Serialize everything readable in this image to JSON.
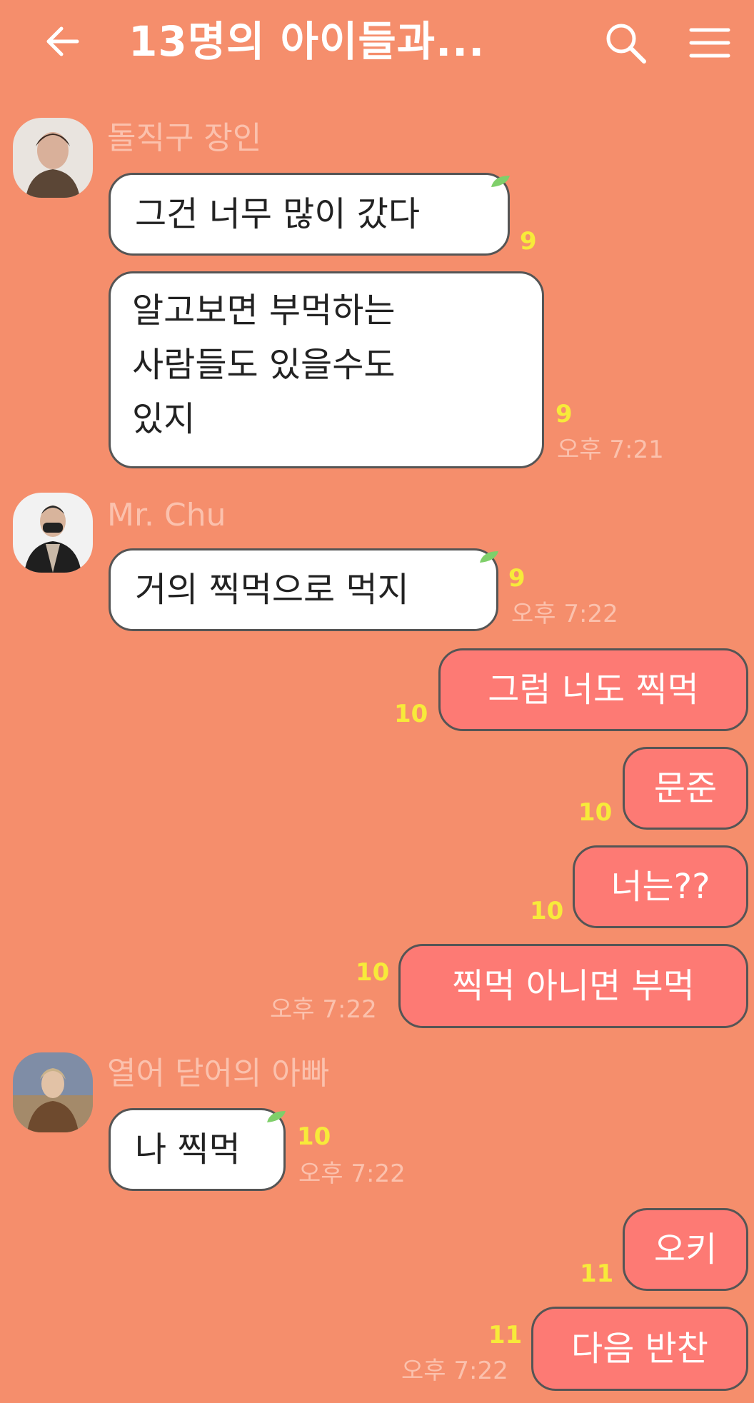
{
  "header": {
    "title": "13명의 아이들과...",
    "back_icon": "arrow-left-icon",
    "search_icon": "search-icon",
    "menu_icon": "hamburger-menu-icon"
  },
  "colors": {
    "background": "#f58e6c",
    "incoming_bubble": "#ffffff",
    "outgoing_bubble": "#fd7a74",
    "unread_count": "#f7ea3a",
    "meta_text": "#fbc1ad"
  },
  "messages": [
    {
      "sender": "돌직구 장인",
      "text": "그건 너무 많이 갔다",
      "unread": "9"
    },
    {
      "lines": [
        "알고보면 부먹하는",
        "사람들도 있을수도",
        "있지"
      ],
      "unread": "9",
      "time": "오후 7:21"
    },
    {
      "sender": "Mr. Chu",
      "text": "거의 찍먹으로 먹지",
      "unread": "9",
      "time": "오후 7:22"
    },
    {
      "text": "그럼 너도 찍먹",
      "unread": "10"
    },
    {
      "text": "문준",
      "unread": "10"
    },
    {
      "text": "너는??",
      "unread": "10"
    },
    {
      "text": "찍먹 아니면 부먹",
      "unread": "10",
      "time": "오후 7:22"
    },
    {
      "sender": "열어 닫어의 아빠",
      "text": "나 찍먹",
      "unread": "10",
      "time": "오후 7:22"
    },
    {
      "text": "오키",
      "unread": "11"
    },
    {
      "text": "다음 반찬",
      "unread": "11",
      "time": "오후 7:22"
    }
  ]
}
